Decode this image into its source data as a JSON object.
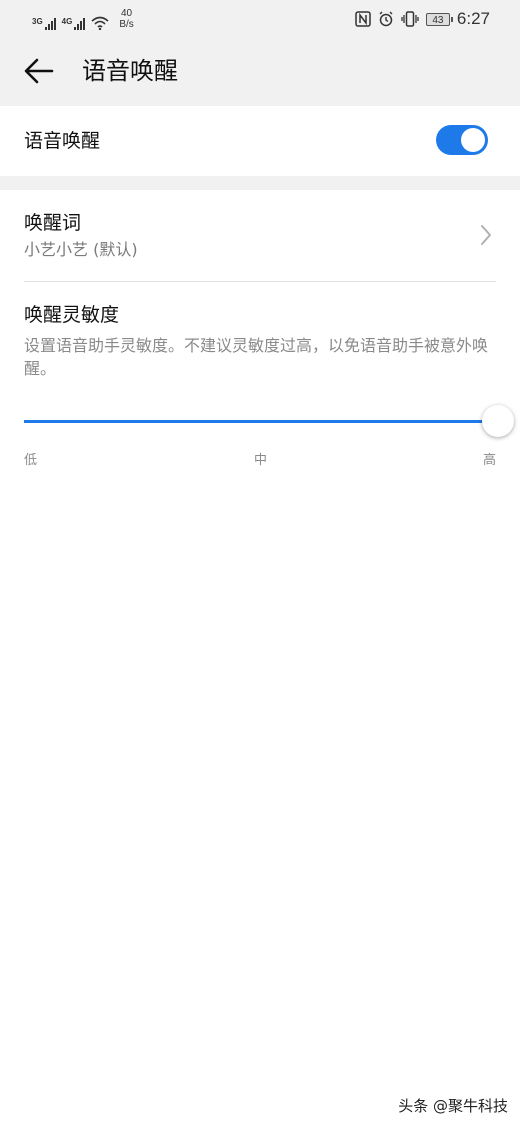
{
  "status_bar": {
    "signal1_label": "3G",
    "signal2_label": "4G",
    "net_speed_value": "40",
    "net_speed_unit": "B/s",
    "icons": [
      "nfc-icon",
      "alarm-icon",
      "vibrate-icon",
      "battery-icon"
    ],
    "battery": "43",
    "time": "6:27"
  },
  "header": {
    "title": "语音唤醒"
  },
  "voice_wake": {
    "label": "语音唤醒",
    "enabled": true
  },
  "wake_word": {
    "title": "唤醒词",
    "value": "小艺小艺 (默认)"
  },
  "sensitivity": {
    "title": "唤醒灵敏度",
    "description": "设置语音助手灵敏度。不建议灵敏度过高，以免语音助手被意外唤醒。",
    "level": 1.0,
    "ticks": [
      "低",
      "中",
      "高"
    ]
  },
  "watermark": "头条 @聚牛科技",
  "colors": {
    "accent": "#1d7ae8",
    "background": "#f1f1f1"
  }
}
